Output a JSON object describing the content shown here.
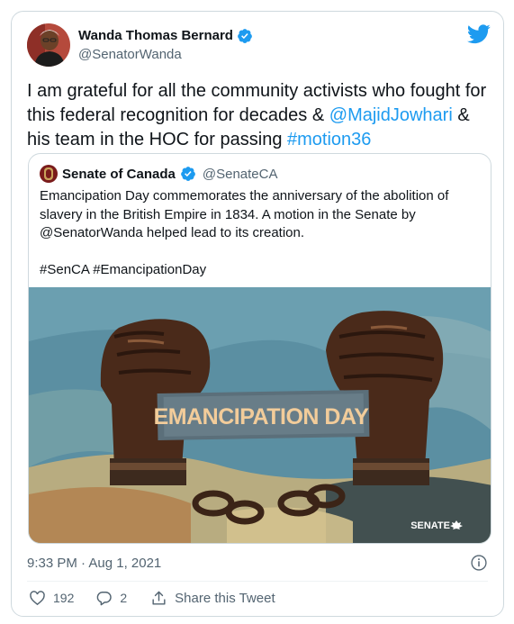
{
  "author": {
    "name": "Wanda Thomas Bernard",
    "handle": "@SenatorWanda",
    "avatar_icon": "author-avatar",
    "verified": true
  },
  "brand": {
    "logo_icon": "twitter-bird-icon",
    "color": "#1d9bf0"
  },
  "tweet": {
    "text_before": "I am grateful for all the community activists who fought for this federal recognition for decades & ",
    "mention": "@MajidJowhari",
    "text_middle": " & his team in the HOC for passing ",
    "hashtag": "#motion36"
  },
  "quote": {
    "name": "Senate of Canada",
    "handle": "@SenateCA",
    "verified": true,
    "text": "Emancipation Day commemorates the anniversary of the abolition of slavery in the British Empire in 1834. A motion in the Senate by @SenatorWanda helped lead to its creation.",
    "hashtags": "#SenCA #EmancipationDay",
    "image": {
      "banner_text": "EMANCIPATION DAY",
      "watermark": "SENATE"
    }
  },
  "timestamp": "9:33 PM · Aug 1, 2021",
  "actions": {
    "likes": "192",
    "replies": "2",
    "share_label": "Share this Tweet"
  }
}
